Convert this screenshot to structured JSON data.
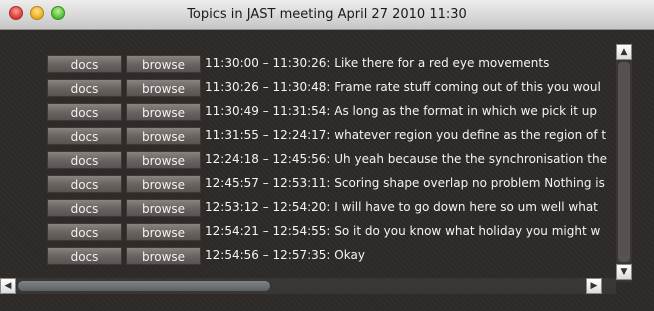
{
  "window": {
    "title": "Topics in JAST meeting April 27 2010 11:30"
  },
  "buttons": {
    "docs_label": "docs",
    "browse_label": "browse"
  },
  "topics": [
    {
      "text": "11:30:00 – 11:30:26: Like there for a red eye movements"
    },
    {
      "text": "11:30:26 – 11:30:48: Frame rate stuff coming out of this you woul"
    },
    {
      "text": "11:30:49 – 11:31:54: As long as the format in which we pick it up"
    },
    {
      "text": "11:31:55 – 12:24:17: whatever region you define as the region of t"
    },
    {
      "text": "12:24:18 – 12:45:56: Uh yeah because the the synchronisation the"
    },
    {
      "text": "12:45:57 – 12:53:11: Scoring shape overlap no problem Nothing is"
    },
    {
      "text": "12:53:12 – 12:54:20: I will have to go down here so um well what"
    },
    {
      "text": "12:54:21 – 12:54:55: So it do you know what holiday you might w"
    },
    {
      "text": "12:54:56 – 12:57:35: Okay"
    }
  ],
  "icons": {
    "scroll_up": "▲",
    "scroll_down": "▼",
    "scroll_left": "◀",
    "scroll_right": "▶"
  }
}
